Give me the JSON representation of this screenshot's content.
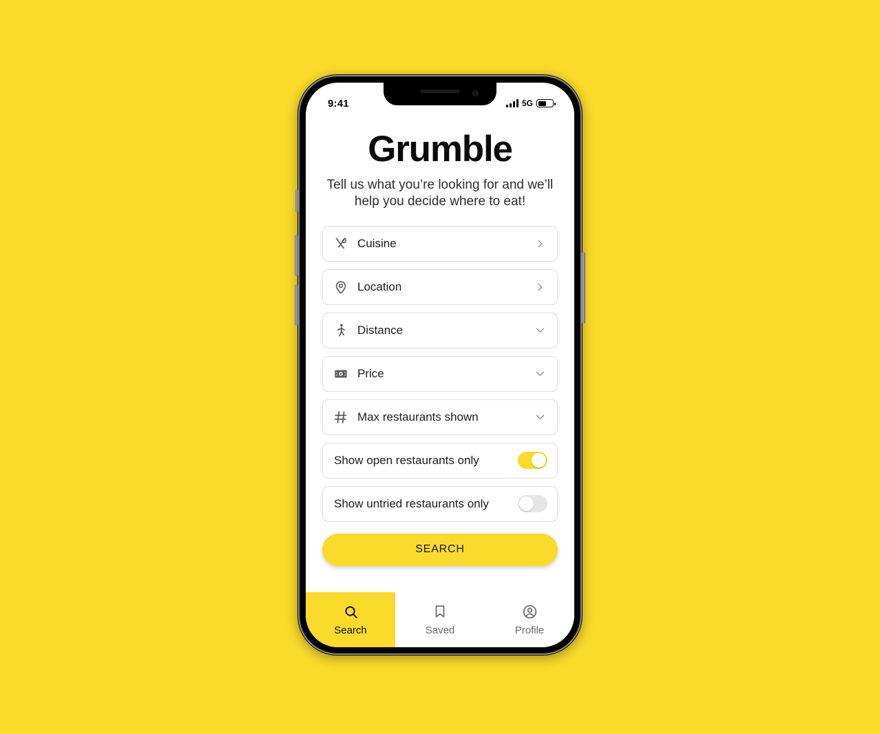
{
  "background_color": "#FADA2B",
  "accent_color": "#FADA2B",
  "device": {
    "status_bar": {
      "time": "9:41",
      "network": "5G",
      "signal_icon": "signal-bars-icon",
      "battery_icon": "battery-icon",
      "battery_level_percent": 55
    }
  },
  "app": {
    "title": "Grumble",
    "subtitle": "Tell us what you’re looking for and we’ll help you decide where to eat!",
    "fields": [
      {
        "label": "Cuisine",
        "icon": "cutlery-icon",
        "chevron": "chevron-right-icon"
      },
      {
        "label": "Location",
        "icon": "map-pin-icon",
        "chevron": "chevron-right-icon"
      },
      {
        "label": "Distance",
        "icon": "walking-icon",
        "chevron": "chevron-down-icon"
      },
      {
        "label": "Price",
        "icon": "banknote-icon",
        "chevron": "chevron-down-icon"
      },
      {
        "label": "Max restaurants shown",
        "icon": "number-sign-icon",
        "chevron": "chevron-down-icon"
      }
    ],
    "toggles": [
      {
        "label": "Show open restaurants only",
        "state": "on"
      },
      {
        "label": "Show untried restaurants only",
        "state": "off"
      }
    ],
    "search_button": {
      "label": "SEARCH"
    },
    "bottom_nav": {
      "items": [
        {
          "label": "Search",
          "icon": "magnifier-icon",
          "active": true
        },
        {
          "label": "Saved",
          "icon": "bookmark-icon",
          "active": false
        },
        {
          "label": "Profile",
          "icon": "user-circle-icon",
          "active": false
        }
      ]
    }
  }
}
